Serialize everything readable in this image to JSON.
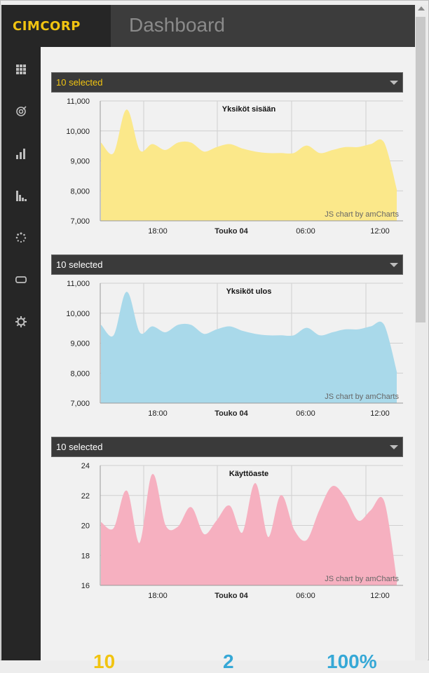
{
  "app": {
    "logo": "CIMCORP",
    "title": "Dashboard"
  },
  "sidebar": {
    "items": [
      {
        "icon": "grid-icon"
      },
      {
        "icon": "target-icon"
      },
      {
        "icon": "bar-chart-icon"
      },
      {
        "icon": "histogram-icon"
      },
      {
        "icon": "spinner-icon"
      },
      {
        "icon": "loop-icon"
      },
      {
        "icon": "gear-icon"
      }
    ]
  },
  "colors": {
    "accent": "#f1c411",
    "yellow": "#fbe88a",
    "blue": "#a9d9ea",
    "pink": "#f6b0c0",
    "stat_yellow": "#f1c411",
    "stat_blue": "#36a8d6"
  },
  "selects": [
    {
      "value": "10 selected",
      "color": "#f1c411"
    },
    {
      "value": "10 selected",
      "color": "#ffffff"
    },
    {
      "value": "10 selected",
      "color": "#ffffff"
    }
  ],
  "credit": "JS chart by amCharts",
  "chart_data": [
    {
      "type": "area",
      "title": "Yksiköt sisään",
      "color": "#fbe88a",
      "ylim": [
        7000,
        11000
      ],
      "yticks": [
        "11,000",
        "10,000",
        "9,000",
        "8,000",
        "7,000"
      ],
      "xticks": [
        "18:00",
        "Touko 04",
        "06:00",
        "12:00"
      ],
      "values": [
        9600,
        9250,
        10700,
        9350,
        9550,
        9350,
        9600,
        9600,
        9300,
        9450,
        9550,
        9400,
        9300,
        9250,
        9250,
        9250,
        9500,
        9250,
        9350,
        9450,
        9450,
        9550,
        9600,
        8000
      ],
      "grid": true
    },
    {
      "type": "area",
      "title": "Yksiköt ulos",
      "color": "#a9d9ea",
      "ylim": [
        7000,
        11000
      ],
      "yticks": [
        "11,000",
        "10,000",
        "9,000",
        "8,000",
        "7,000"
      ],
      "xticks": [
        "18:00",
        "Touko 04",
        "06:00",
        "12:00"
      ],
      "values": [
        9600,
        9250,
        10700,
        9350,
        9550,
        9350,
        9600,
        9600,
        9300,
        9450,
        9550,
        9400,
        9300,
        9250,
        9250,
        9250,
        9500,
        9250,
        9350,
        9450,
        9450,
        9550,
        9600,
        8000
      ],
      "grid": true
    },
    {
      "type": "area",
      "title": "Käyttöaste",
      "color": "#f6b0c0",
      "ylim": [
        16,
        24
      ],
      "yticks": [
        "24",
        "22",
        "20",
        "18",
        "16"
      ],
      "xticks": [
        "18:00",
        "Touko 04",
        "06:00",
        "12:00"
      ],
      "values": [
        20.2,
        19.8,
        22.3,
        18.8,
        23.4,
        20.0,
        19.9,
        21.2,
        19.4,
        20.3,
        21.3,
        19.5,
        22.8,
        19.2,
        22.0,
        19.7,
        19.0,
        21.0,
        22.6,
        21.8,
        20.3,
        21.0,
        21.6,
        16.2
      ],
      "grid": true
    }
  ],
  "stats": [
    {
      "value": "10",
      "color": "#f1c411"
    },
    {
      "value": "2",
      "color": "#36a8d6"
    },
    {
      "value": "100%",
      "color": "#36a8d6"
    }
  ]
}
